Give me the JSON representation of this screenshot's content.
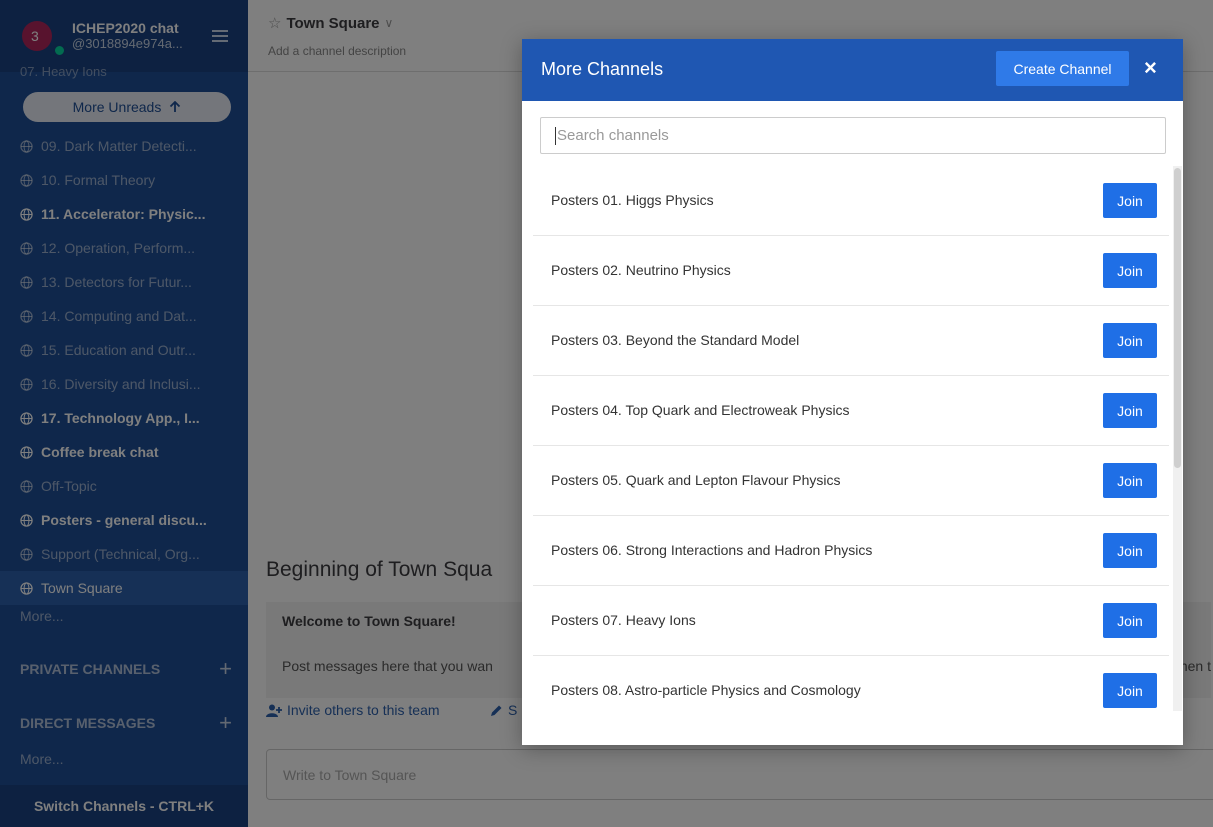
{
  "sidebar": {
    "team_name": "ICHEP2020 chat",
    "username": "@3018894e974a...",
    "badge_count": "3",
    "cut_item": "07. Heavy Ions",
    "more_unreads": "More Unreads",
    "channels": [
      {
        "label": "09. Dark Matter Detecti...",
        "bold": false
      },
      {
        "label": "10. Formal Theory",
        "bold": false
      },
      {
        "label": "11. Accelerator: Physic...",
        "bold": true
      },
      {
        "label": "12. Operation, Perform...",
        "bold": false
      },
      {
        "label": "13. Detectors for Futur...",
        "bold": false
      },
      {
        "label": "14. Computing and Dat...",
        "bold": false
      },
      {
        "label": "15. Education and Outr...",
        "bold": false
      },
      {
        "label": "16. Diversity and Inclusi...",
        "bold": false
      },
      {
        "label": "17. Technology App., I...",
        "bold": true
      },
      {
        "label": "Coffee break chat",
        "bold": true
      },
      {
        "label": "Off-Topic",
        "bold": false
      },
      {
        "label": "Posters - general discu...",
        "bold": true
      },
      {
        "label": "Support (Technical, Org...",
        "bold": false
      },
      {
        "label": "Town Square",
        "bold": false,
        "active": true
      }
    ],
    "more": "More...",
    "private_channels": "PRIVATE CHANNELS",
    "direct_messages": "DIRECT MESSAGES",
    "more2": "More...",
    "switch_channels": "Switch Channels - CTRL+K"
  },
  "main": {
    "channel_title": "Town Square",
    "channel_desc": "Add a channel description",
    "beginning": "Beginning of Town Squa",
    "welcome_title": "Welcome to Town Square!",
    "welcome_text": "Post messages here that you wan",
    "welcome_text_end": "hen t",
    "invite": "Invite others to this team",
    "edit_partial": "S",
    "composer_placeholder": "Write to Town Square"
  },
  "modal": {
    "title": "More Channels",
    "create_button": "Create Channel",
    "close": "×",
    "search_placeholder": "Search channels",
    "join_label": "Join",
    "channels": [
      "Posters 01. Higgs Physics",
      "Posters 02. Neutrino Physics",
      "Posters 03. Beyond the Standard Model",
      "Posters 04. Top Quark and Electroweak Physics",
      "Posters 05. Quark and Lepton Flavour Physics",
      "Posters 06. Strong Interactions and Hadron Physics",
      "Posters 07. Heavy Ions",
      "Posters 08. Astro-particle Physics and Cosmology"
    ]
  },
  "colors": {
    "sidebar_bg": "#1f4f96",
    "modal_header": "#1f57b2",
    "button_blue": "#1f6fe6"
  }
}
